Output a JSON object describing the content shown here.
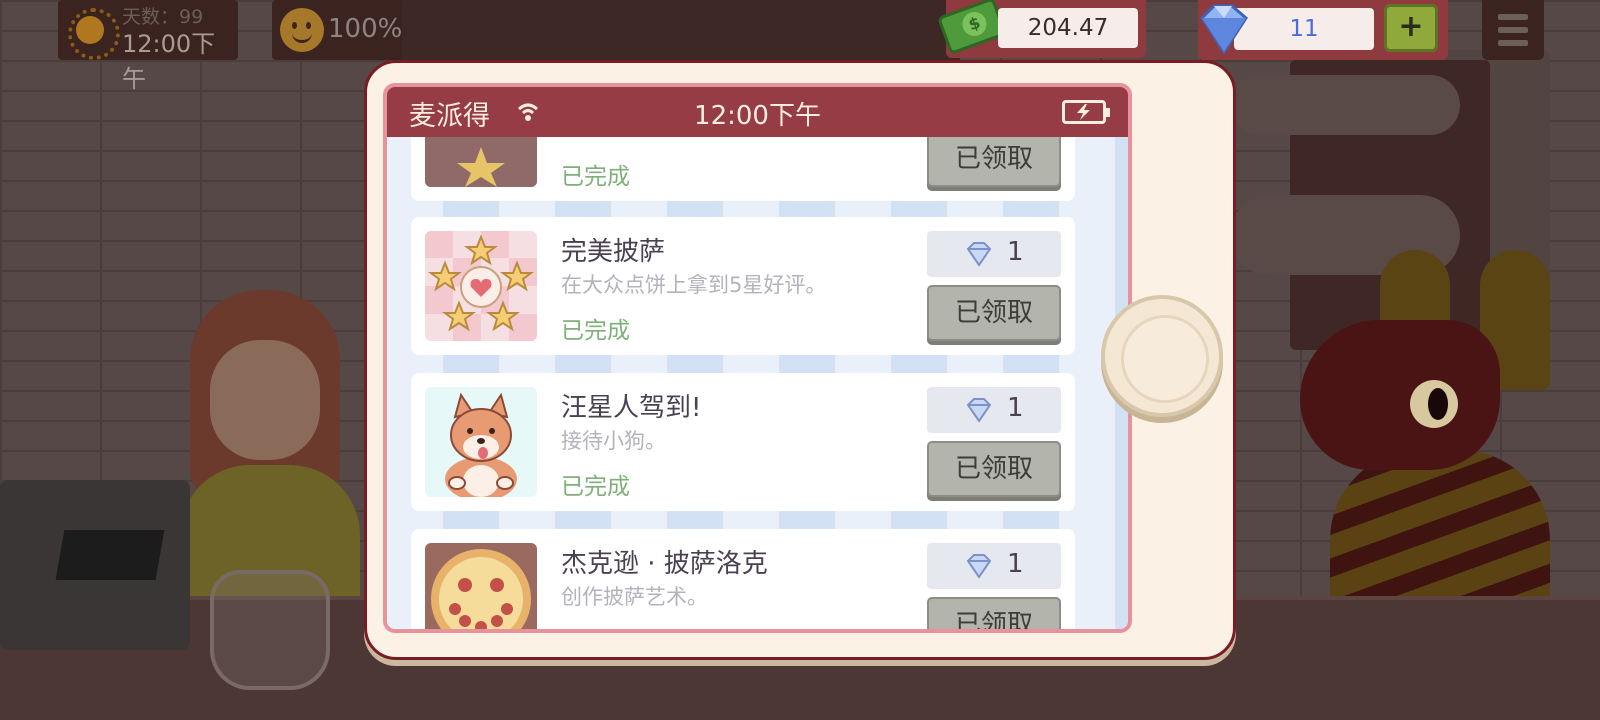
{
  "hud": {
    "day_label": "天数：99",
    "day_time": "12:00下午",
    "mood_value": "100%",
    "money_value": "204.47",
    "gems_value": "11",
    "plus_label": "+"
  },
  "phone": {
    "carrier": "麦派得",
    "time": "12:00下午"
  },
  "achievements": [
    {
      "title": "",
      "description": "",
      "status": "已完成",
      "reward": "",
      "button": "已领取"
    },
    {
      "title": "完美披萨",
      "description": "在大众点饼上拿到5星好评。",
      "status": "已完成",
      "reward": "1",
      "button": "已领取"
    },
    {
      "title": "汪星人驾到!",
      "description": "接待小狗。",
      "status": "已完成",
      "reward": "1",
      "button": "已领取"
    },
    {
      "title": "杰克逊 · 披萨洛克",
      "description": "创作披萨艺术。",
      "status": "",
      "reward": "1",
      "button": "已领取"
    }
  ],
  "colors": {
    "status_bar": "#953c44",
    "completed_text": "#7fb07a",
    "gem_text": "#4a6bd8",
    "claimed_button": "#b3b4ab"
  },
  "icons": [
    "sun-icon",
    "smiley-icon",
    "cash-icon",
    "gem-icon",
    "plus-icon",
    "menu-icon",
    "wifi-icon",
    "battery-icon",
    "diamond-icon"
  ]
}
